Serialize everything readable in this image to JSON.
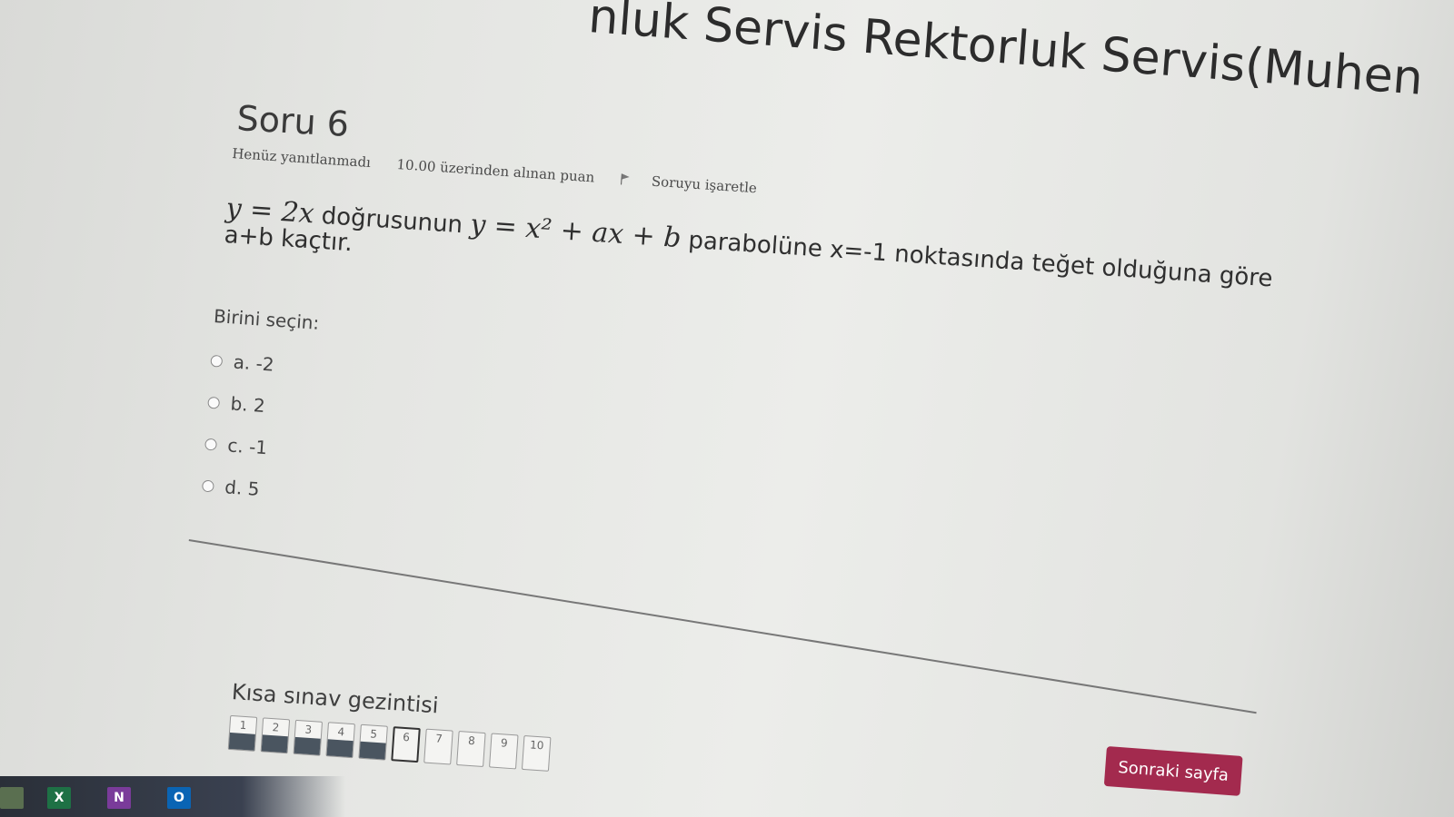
{
  "header": {
    "title": "nluk Servis Rektorluk Servis(Muhen"
  },
  "question": {
    "title": "Soru 6",
    "state": "Henüz yanıtlanmadı",
    "grade": "10.00 üzerinden alınan puan",
    "flag_label": "Soruyu işaretle",
    "text_math1": "y = 2x",
    "text_part1": " doğrusunun ",
    "text_math2": "y = x² + ax + b",
    "text_part2": " parabolüne x=-1 noktasında teğet olduğuna göre",
    "text_line2": "a+b kaçtır."
  },
  "answers": {
    "prompt": "Birini seçin:",
    "options": [
      {
        "label": "a. -2"
      },
      {
        "label": "b. 2"
      },
      {
        "label": "c. -1"
      },
      {
        "label": "d. 5"
      }
    ]
  },
  "navigation": {
    "title": "Kısa sınav gezintisi",
    "buttons": [
      "1",
      "2",
      "3",
      "4",
      "5",
      "6",
      "7",
      "8",
      "9",
      "10"
    ],
    "current": "6"
  },
  "footer": {
    "next_label": "Sonraki sayfa"
  },
  "taskbar": {
    "icons": [
      {
        "name": "app-icon",
        "glyph": ""
      },
      {
        "name": "excel-icon",
        "glyph": "X"
      },
      {
        "name": "onenote-icon",
        "glyph": "N"
      },
      {
        "name": "outlook-icon",
        "glyph": "O"
      }
    ]
  },
  "colors": {
    "accent": "#a32a4e",
    "answered": "#4a5560"
  }
}
